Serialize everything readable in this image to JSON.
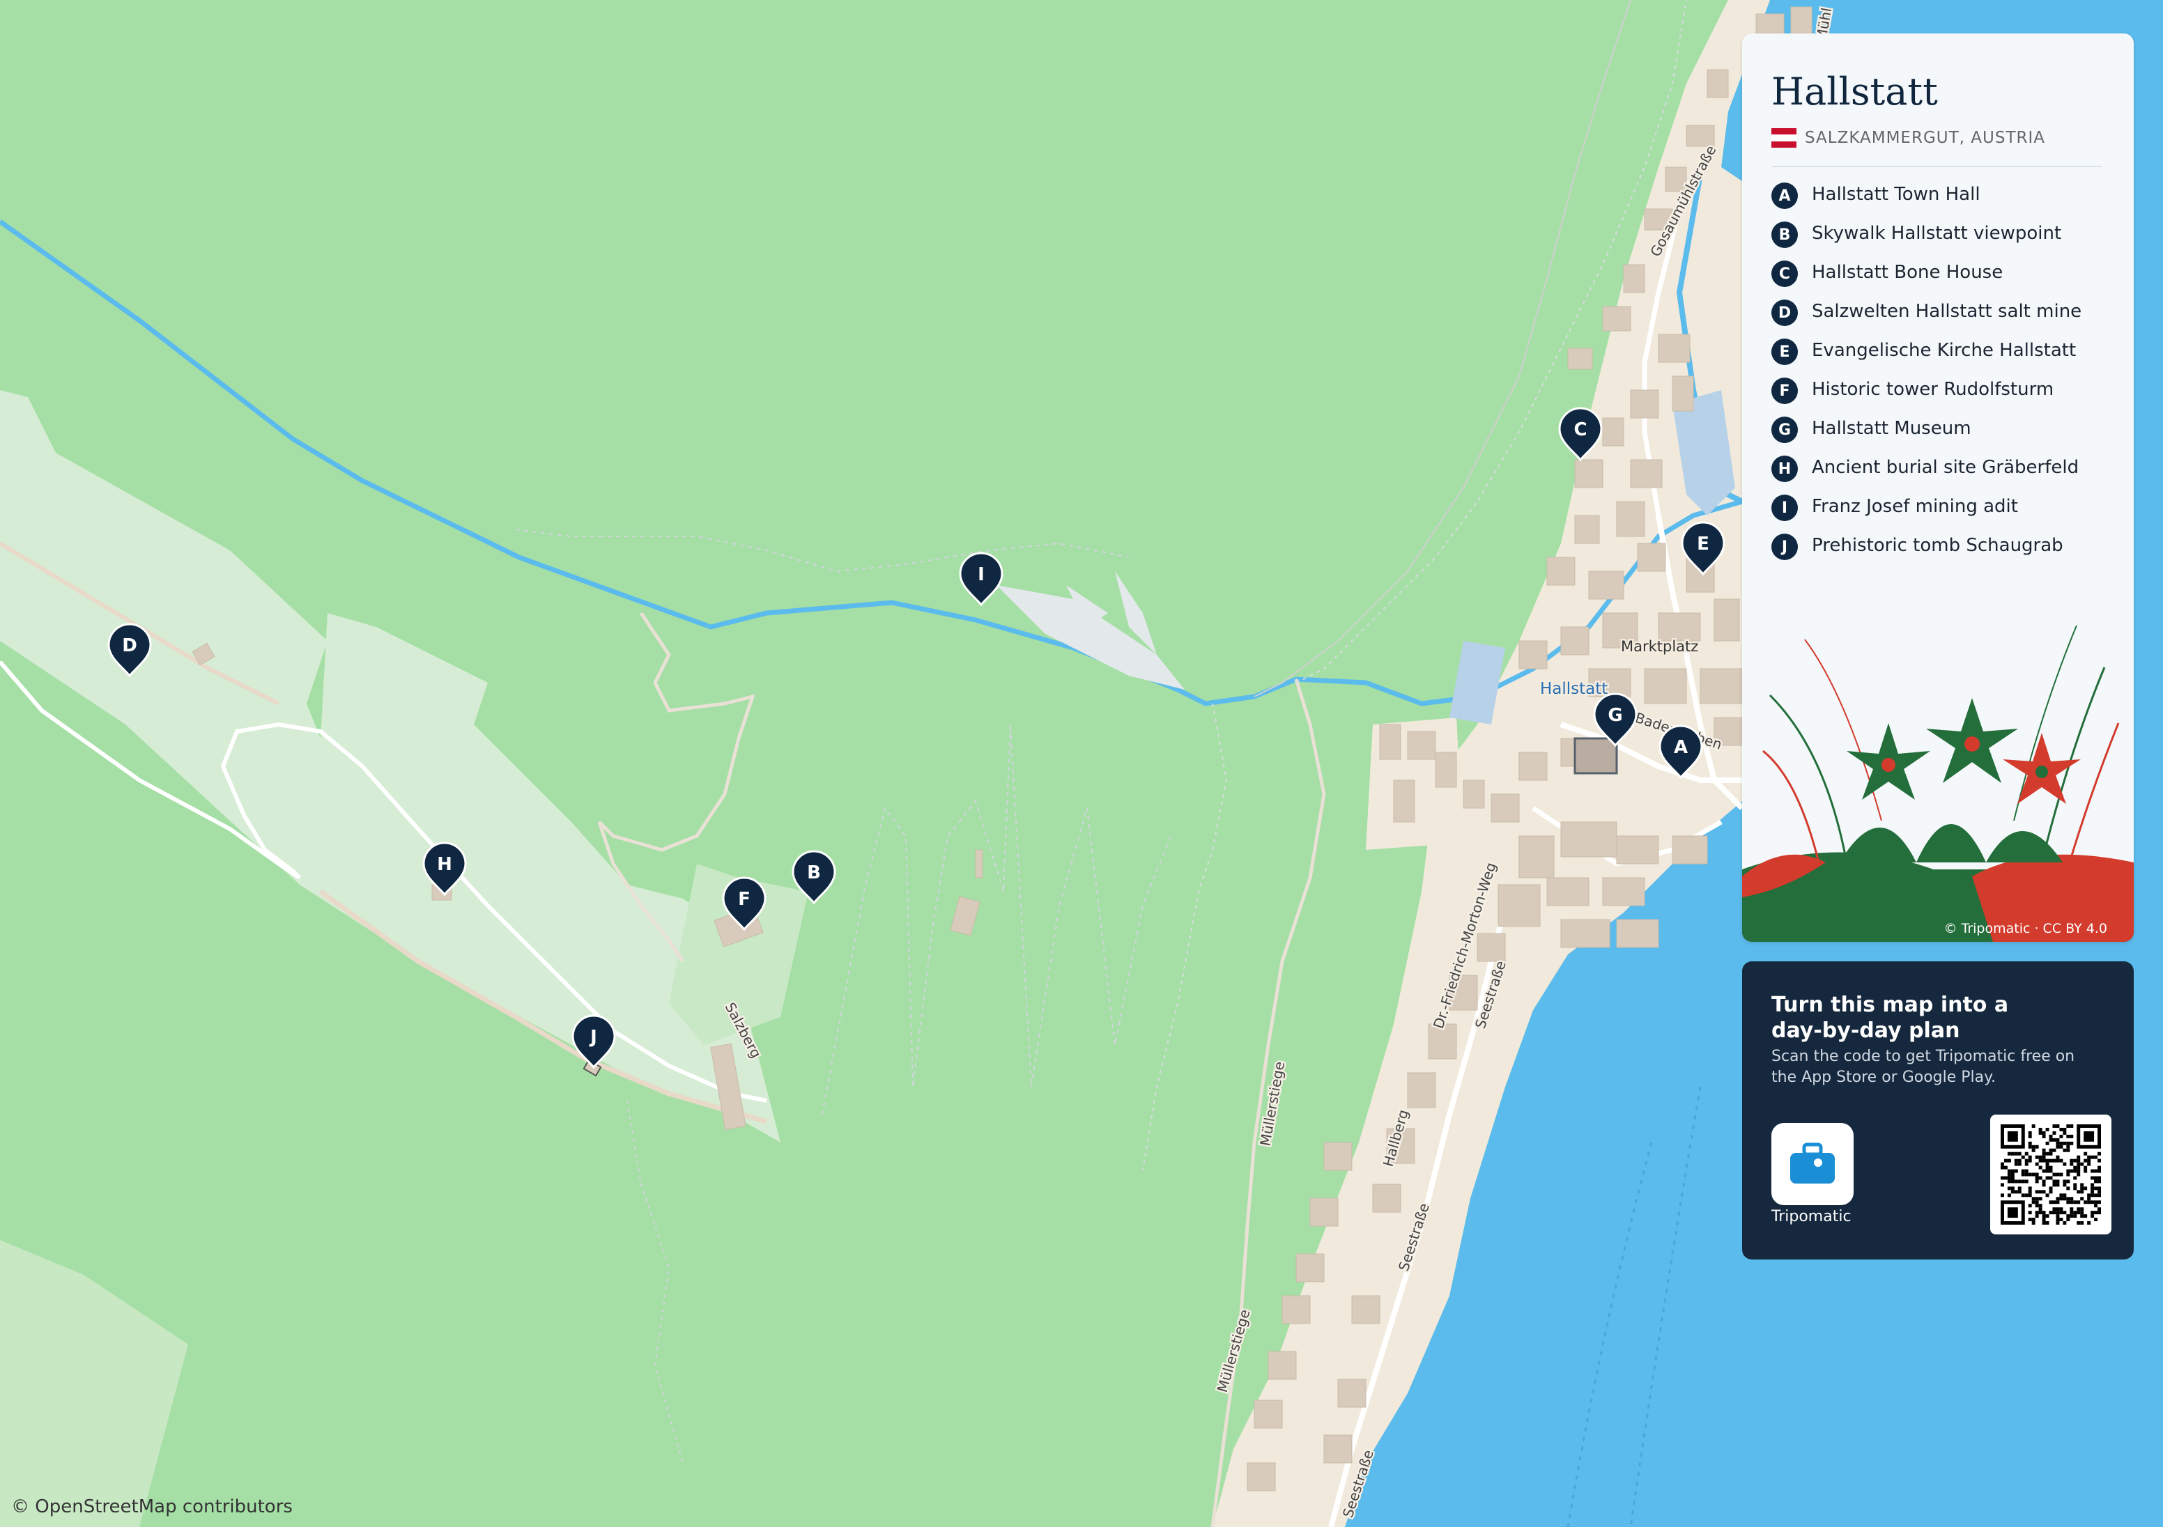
{
  "map": {
    "attribution": "© OpenStreetMap contributors",
    "labels": {
      "gosaumuehlstrasse": "Gosaumühlstraße",
      "marktplatz": "Marktplatz",
      "hallstatt": "Hallstatt",
      "badergraben": "Badergraben",
      "friedrich": "Dr.-Friedrich-Morton-Weg",
      "seestrasse1": "Seestraße",
      "seestrasse2": "Seestraße",
      "seestrasse3": "Seestraße",
      "hallberg": "Hallberg",
      "muellersteig1": "Müllerstiege",
      "muellersteig2": "Müllerstiege",
      "salzberg": "Salzberg",
      "muehl": "Mühl"
    },
    "markers": [
      {
        "letter": "A"
      },
      {
        "letter": "B"
      },
      {
        "letter": "C"
      },
      {
        "letter": "D"
      },
      {
        "letter": "E"
      },
      {
        "letter": "F"
      },
      {
        "letter": "G"
      },
      {
        "letter": "H"
      },
      {
        "letter": "I"
      },
      {
        "letter": "J"
      }
    ],
    "colors": {
      "forest": "#a5dfa5",
      "meadow": "#d6ecd4",
      "water": "#5bbbec",
      "urban": "#f1eadc",
      "building": "#d8cbbb",
      "marker": "#0f2740"
    }
  },
  "card": {
    "title": "Hallstatt",
    "subtitle": "SALZKAMMERGUT, AUSTRIA",
    "flag_colors": [
      "#c8102e",
      "#ffffff",
      "#c8102e"
    ],
    "credit": "© Tripomatic · CC BY 4.0",
    "pois": [
      {
        "letter": "A",
        "name": "Hallstatt Town Hall"
      },
      {
        "letter": "B",
        "name": "Skywalk Hallstatt viewpoint"
      },
      {
        "letter": "C",
        "name": "Hallstatt Bone House"
      },
      {
        "letter": "D",
        "name": "Salzwelten Hallstatt salt mine"
      },
      {
        "letter": "E",
        "name": "Evangelische Kirche Hallstatt"
      },
      {
        "letter": "F",
        "name": "Historic tower Rudolfsturm"
      },
      {
        "letter": "G",
        "name": "Hallstatt Museum"
      },
      {
        "letter": "H",
        "name": "Ancient burial site Gräberfeld"
      },
      {
        "letter": "I",
        "name": "Franz Josef mining adit"
      },
      {
        "letter": "J",
        "name": "Prehistoric tomb Schaugrab"
      }
    ]
  },
  "promo": {
    "title": "Turn this map into a day-by-day plan",
    "text": "Scan the code to get Tripomatic free on the App Store or Google Play.",
    "app_name": "Tripomatic",
    "app_icon": "suitcase-icon",
    "accent": "#1a8fd6"
  }
}
